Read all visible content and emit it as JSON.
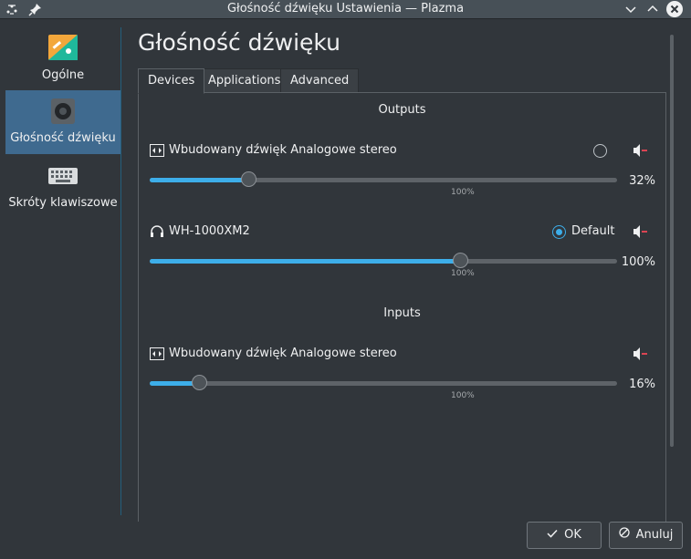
{
  "window": {
    "title": "Głośność dźwięku Ustawienia — Plazma",
    "minimize_icon": "chevron-down",
    "maximize_icon": "chevron-up",
    "close_icon": "x-circle"
  },
  "sidebar": {
    "items": [
      {
        "label": "Ogólne",
        "icon": "general-settings-icon"
      },
      {
        "label": "Głośność dźwięku",
        "icon": "speaker-icon",
        "active": true
      },
      {
        "label": "Skróty klawiszowe",
        "icon": "keyboard-icon"
      }
    ]
  },
  "page": {
    "title": "Głośność dźwięku"
  },
  "tabs": [
    {
      "label": "Devices",
      "active": true
    },
    {
      "label": "Applications"
    },
    {
      "label": "Advanced"
    }
  ],
  "outputs": {
    "title": "Outputs",
    "devices": [
      {
        "name": "Wbudowany dźwięk Analogowe stereo",
        "icon": "audio-card-icon",
        "volume": 32,
        "volume_label": "32%",
        "tick_label": "100%",
        "is_default": false
      },
      {
        "name": "WH-1000XM2",
        "icon": "headphones-icon",
        "volume": 100,
        "volume_label": "100%",
        "tick_label": "100%",
        "is_default": true,
        "default_label": "Default"
      }
    ]
  },
  "inputs": {
    "title": "Inputs",
    "devices": [
      {
        "name": "Wbudowany dźwięk Analogowe stereo",
        "icon": "audio-card-icon",
        "volume": 16,
        "volume_label": "16%",
        "tick_label": "100%"
      }
    ]
  },
  "buttons": {
    "ok": "OK",
    "cancel": "Anuluj"
  },
  "colors": {
    "accent": "#3daee9",
    "background": "#31363b",
    "selection": "#3f6a8f",
    "mute_red": "#da4453"
  }
}
